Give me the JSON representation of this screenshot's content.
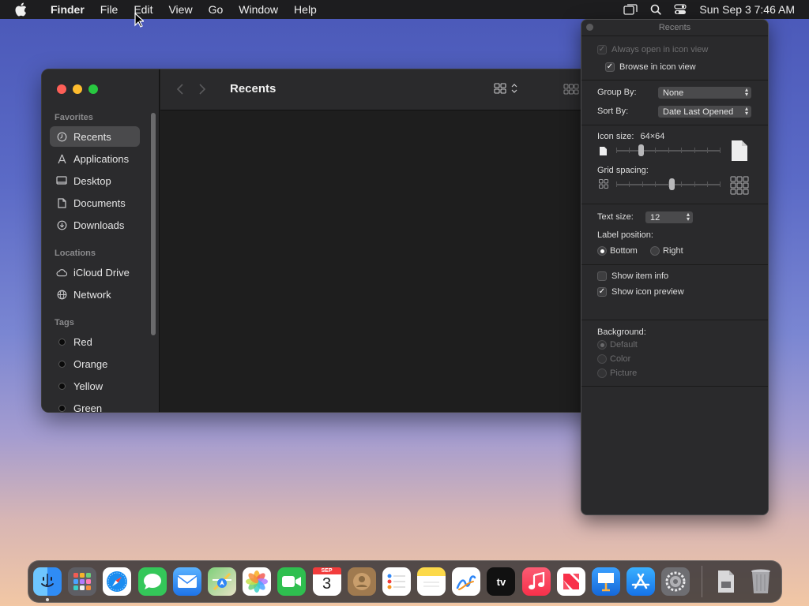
{
  "menubar": {
    "app_name": "Finder",
    "items": [
      "File",
      "Edit",
      "View",
      "Go",
      "Window",
      "Help"
    ],
    "clock": "Sun Sep 3  7:46 AM"
  },
  "finder": {
    "title": "Recents",
    "sidebar": {
      "favorites_label": "Favorites",
      "favorites": [
        {
          "label": "Recents",
          "icon": "clock-icon",
          "selected": true
        },
        {
          "label": "Applications",
          "icon": "applications-icon"
        },
        {
          "label": "Desktop",
          "icon": "desktop-icon"
        },
        {
          "label": "Documents",
          "icon": "document-icon"
        },
        {
          "label": "Downloads",
          "icon": "download-icon"
        }
      ],
      "locations_label": "Locations",
      "locations": [
        {
          "label": "iCloud Drive",
          "icon": "cloud-icon"
        },
        {
          "label": "Network",
          "icon": "globe-icon"
        }
      ],
      "tags_label": "Tags",
      "tags": [
        {
          "label": "Red"
        },
        {
          "label": "Orange"
        },
        {
          "label": "Yellow"
        },
        {
          "label": "Green"
        }
      ]
    }
  },
  "inspector": {
    "title": "Recents",
    "always_open_icon_view": {
      "label": "Always open in icon view",
      "checked": true,
      "enabled": false
    },
    "browse_icon_view": {
      "label": "Browse in icon view",
      "checked": true
    },
    "group_by": {
      "label": "Group By:",
      "value": "None"
    },
    "sort_by": {
      "label": "Sort By:",
      "value": "Date Last Opened"
    },
    "icon_size": {
      "label": "Icon size:",
      "value": "64×64"
    },
    "grid_spacing": {
      "label": "Grid spacing:"
    },
    "text_size": {
      "label": "Text size:",
      "value": "12"
    },
    "label_position": {
      "label": "Label position:",
      "options": [
        "Bottom",
        "Right"
      ],
      "selected": "Bottom"
    },
    "show_item_info": {
      "label": "Show item info",
      "checked": false
    },
    "show_icon_preview": {
      "label": "Show icon preview",
      "checked": true
    },
    "background": {
      "label": "Background:",
      "options": [
        "Default",
        "Color",
        "Picture"
      ],
      "selected": "Default",
      "enabled": false
    }
  },
  "dock": {
    "apps": [
      {
        "name": "finder-icon",
        "color": "#2f8cf5"
      },
      {
        "name": "launchpad-icon",
        "color": "#6d6d73"
      },
      {
        "name": "safari-icon",
        "color": "#1a8cf0"
      },
      {
        "name": "messages-icon",
        "color": "#34c759"
      },
      {
        "name": "mail-icon",
        "color": "#2f86f6"
      },
      {
        "name": "maps-icon",
        "color": "#5fb65a"
      },
      {
        "name": "photos-icon",
        "color": "#ffffff"
      },
      {
        "name": "facetime-icon",
        "color": "#2fbf4f"
      },
      {
        "name": "calendar-icon",
        "color": "#ffffff",
        "month": "SEP",
        "day": "3"
      },
      {
        "name": "contacts-icon",
        "color": "#a07a4f"
      },
      {
        "name": "reminders-icon",
        "color": "#ffffff"
      },
      {
        "name": "notes-icon",
        "color": "#fcd94a"
      },
      {
        "name": "freeform-icon",
        "color": "#ffffff"
      },
      {
        "name": "appletv-icon",
        "color": "#111111",
        "text": "tv"
      },
      {
        "name": "music-icon",
        "color": "#fa3a4f"
      },
      {
        "name": "news-icon",
        "color": "#ffffff"
      },
      {
        "name": "keynote-icon",
        "color": "#2a8cf0"
      },
      {
        "name": "appstore-icon",
        "color": "#1d8ef5"
      },
      {
        "name": "system-settings-icon",
        "color": "#6e6e72"
      }
    ],
    "downloads_stack": {
      "name": "downloads-stack-icon",
      "color": "#d8d8da"
    },
    "trash": {
      "name": "trash-icon",
      "color": "#a8a8ac"
    }
  }
}
